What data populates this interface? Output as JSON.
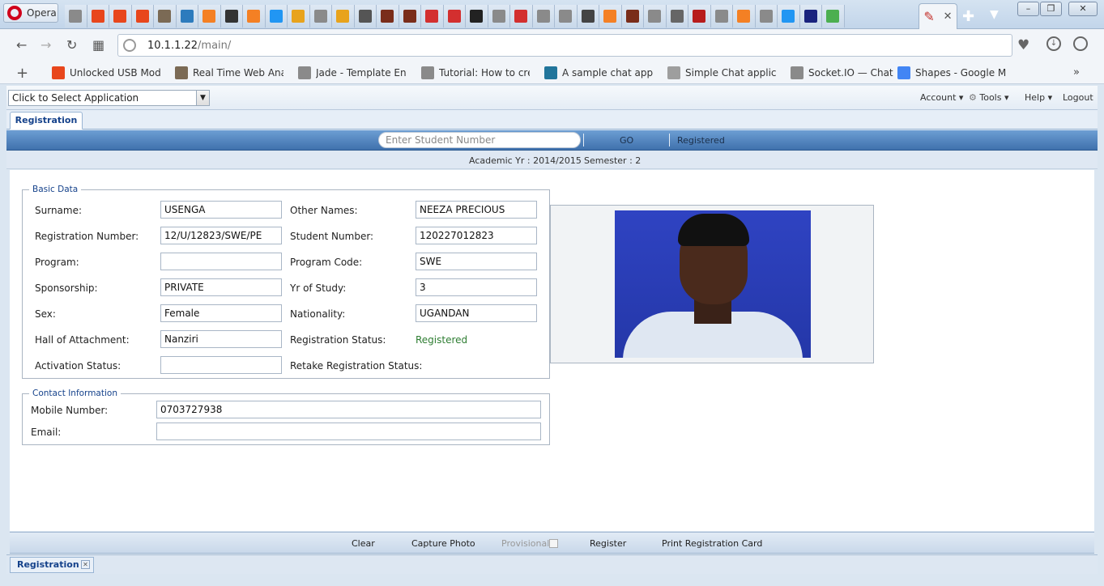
{
  "browser": {
    "name": "Opera",
    "url_host": "10.1.1.22",
    "url_path": "/main/",
    "tab_favicons": [
      {
        "icon": "page-icon",
        "color": "#8a8a8a"
      },
      {
        "icon": "blogger-b-icon",
        "color": "#e8461c"
      },
      {
        "icon": "blogger-b-icon",
        "color": "#e8461c"
      },
      {
        "icon": "blogger-b-icon",
        "color": "#e8461c"
      },
      {
        "icon": "avatar-icon",
        "color": "#7b6a55"
      },
      {
        "icon": "wifi-icon",
        "color": "#2d7bbd"
      },
      {
        "icon": "stack-icon",
        "color": "#f48024"
      },
      {
        "icon": "bird-icon",
        "color": "#333333"
      },
      {
        "icon": "stack-icon",
        "color": "#f48024"
      },
      {
        "icon": "diamond-icon",
        "color": "#2196f3"
      },
      {
        "icon": "m-icon",
        "color": "#e8a31c"
      },
      {
        "icon": "page-icon",
        "color": "#8a8a8a"
      },
      {
        "icon": "m-icon",
        "color": "#e8a31c"
      },
      {
        "icon": "p-icon",
        "color": "#555555"
      },
      {
        "icon": "image-icon",
        "color": "#7a2d1a"
      },
      {
        "icon": "image-icon",
        "color": "#7a2d1a"
      },
      {
        "icon": "red-doc-icon",
        "color": "#d32f2f"
      },
      {
        "icon": "red-doc-icon",
        "color": "#d32f2f"
      },
      {
        "icon": "github-icon",
        "color": "#222222"
      },
      {
        "icon": "page-icon",
        "color": "#8a8a8a"
      },
      {
        "icon": "red-doc-icon",
        "color": "#d32f2f"
      },
      {
        "icon": "page-icon",
        "color": "#8a8a8a"
      },
      {
        "icon": "page-icon",
        "color": "#8a8a8a"
      },
      {
        "icon": "af-icon",
        "color": "#444444"
      },
      {
        "icon": "stack-icon",
        "color": "#f48024"
      },
      {
        "icon": "image-icon",
        "color": "#7a2d1a"
      },
      {
        "icon": "page-icon",
        "color": "#8a8a8a"
      },
      {
        "icon": "lock-doc-icon",
        "color": "#666666"
      },
      {
        "icon": "q-icon",
        "color": "#b71c1c"
      },
      {
        "icon": "page-icon",
        "color": "#8a8a8a"
      },
      {
        "icon": "stack-icon",
        "color": "#f48024"
      },
      {
        "icon": "page-icon",
        "color": "#8a8a8a"
      },
      {
        "icon": "chevron-icon",
        "color": "#2196f3"
      },
      {
        "icon": "f-icon",
        "color": "#1a237e"
      },
      {
        "icon": "leaf-icon",
        "color": "#4caf50"
      }
    ],
    "bookmarks": [
      {
        "label": "Unlocked USB Modem",
        "icon": "blogger-b-icon",
        "color": "#e8461c"
      },
      {
        "label": "Real Time Web Analytics",
        "icon": "avatar-icon",
        "color": "#7b6a55"
      },
      {
        "label": "Jade - Template Engine",
        "icon": "page-icon",
        "color": "#8a8a8a"
      },
      {
        "label": "Tutorial: How to create",
        "icon": "page-icon",
        "color": "#8a8a8a"
      },
      {
        "label": "A sample chat application",
        "icon": "wordpress-icon",
        "color": "#21759b"
      },
      {
        "label": "Simple Chat application",
        "icon": "lines-icon",
        "color": "#9e9e9e"
      },
      {
        "label": "Socket.IO — Chat",
        "icon": "page-icon",
        "color": "#8a8a8a"
      },
      {
        "label": "Shapes - Google Maps",
        "icon": "google-icon",
        "color": "#4285f4"
      }
    ]
  },
  "app": {
    "app_selector": "Click to Select Application",
    "menu": {
      "account": "Account ▾",
      "tools": "Tools ▾",
      "help": "Help ▾",
      "logout": "Logout"
    },
    "active_tab": "Registration",
    "search_placeholder": "Enter Student Number",
    "go_label": "GO",
    "registered_label": "Registered",
    "academic_year": "Academic Yr : 2014/2015",
    "semester": "Semester : 2",
    "basic_data": {
      "legend": "Basic Data",
      "surname_label": "Surname:",
      "surname": "USENGA",
      "other_names_label": "Other Names:",
      "other_names": "NEEZA PRECIOUS",
      "reg_number_label": "Registration Number:",
      "reg_number": "12/U/12823/SWE/PE",
      "student_number_label": "Student Number:",
      "student_number": "120227012823",
      "program_label": "Program:",
      "program": "",
      "program_code_label": "Program Code:",
      "program_code": "SWE",
      "sponsorship_label": "Sponsorship:",
      "sponsorship": "PRIVATE",
      "yr_of_study_label": "Yr of Study:",
      "yr_of_study": "3",
      "sex_label": "Sex:",
      "sex": "Female",
      "nationality_label": "Nationality:",
      "nationality": "UGANDAN",
      "hall_label": "Hall of Attachment:",
      "hall": "Nanziri",
      "reg_status_label": "Registration Status:",
      "reg_status": "Registered",
      "activation_label": "Activation Status:",
      "activation": "",
      "retake_label": "Retake Registration Status:"
    },
    "contact": {
      "legend": "Contact Information",
      "mobile_label": "Mobile Number:",
      "mobile": "0703727938",
      "email_label": "Email:",
      "email": ""
    },
    "actions": {
      "clear": "Clear",
      "capture_photo": "Capture Photo",
      "provisional": "Provisional",
      "register": "Register",
      "print_card": "Print Registration Card"
    },
    "bottom_tab": "Registration"
  }
}
